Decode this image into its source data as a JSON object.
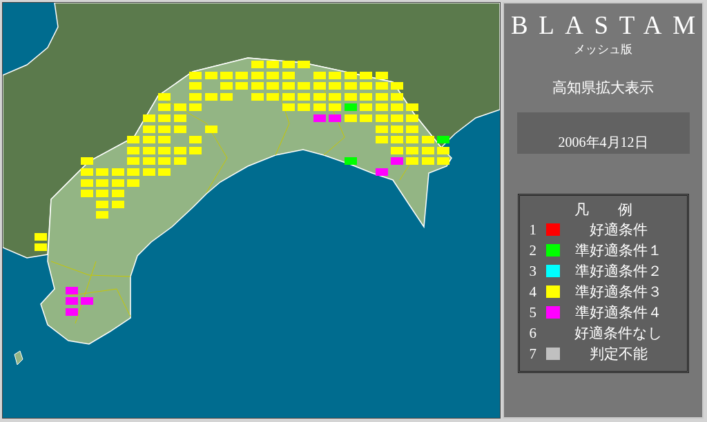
{
  "map": {
    "mesh_rows": [
      {
        "cells": [
          {
            "kind": "blank"
          },
          {
            "kind": "blank"
          },
          {
            "kind": "blank"
          },
          {
            "kind": "blank"
          },
          {
            "kind": "blank"
          },
          {
            "kind": "blank"
          },
          {
            "kind": "blank"
          },
          {
            "kind": "blank"
          },
          {
            "kind": "blank"
          },
          {
            "kind": "blank"
          },
          {
            "kind": "blank"
          },
          {
            "kind": "blank"
          },
          {
            "kind": "blank"
          },
          {
            "kind": "blank"
          },
          {
            "kind": "mesh",
            "color": "#ffff00"
          },
          {
            "kind": "mesh",
            "color": "#ffff00"
          },
          {
            "kind": "mesh",
            "color": "#ffff00"
          },
          {
            "kind": "mesh",
            "color": "#ffff00"
          }
        ]
      },
      {
        "cells": [
          {
            "kind": "blank"
          },
          {
            "kind": "blank"
          },
          {
            "kind": "blank"
          },
          {
            "kind": "blank"
          },
          {
            "kind": "blank"
          },
          {
            "kind": "blank"
          },
          {
            "kind": "blank"
          },
          {
            "kind": "blank"
          },
          {
            "kind": "blank"
          },
          {
            "kind": "blank"
          },
          {
            "kind": "mesh",
            "color": "#ffff00"
          },
          {
            "kind": "mesh",
            "color": "#ffff00"
          },
          {
            "kind": "mesh",
            "color": "#ffff00"
          },
          {
            "kind": "mesh",
            "color": "#ffff00"
          },
          {
            "kind": "mesh",
            "color": "#ffff00"
          },
          {
            "kind": "mesh",
            "color": "#ffff00"
          },
          {
            "kind": "mesh",
            "color": "#ffff00"
          },
          {
            "kind": "blank"
          },
          {
            "kind": "mesh",
            "color": "#ffff00"
          },
          {
            "kind": "mesh",
            "color": "#ffff00"
          },
          {
            "kind": "mesh",
            "color": "#ffff00"
          },
          {
            "kind": "mesh",
            "color": "#ffff00"
          },
          {
            "kind": "mesh",
            "color": "#ffff00"
          }
        ]
      },
      {
        "cells": [
          {
            "kind": "blank"
          },
          {
            "kind": "blank"
          },
          {
            "kind": "blank"
          },
          {
            "kind": "blank"
          },
          {
            "kind": "blank"
          },
          {
            "kind": "blank"
          },
          {
            "kind": "blank"
          },
          {
            "kind": "blank"
          },
          {
            "kind": "blank"
          },
          {
            "kind": "blank"
          },
          {
            "kind": "mesh",
            "color": "#ffff00"
          },
          {
            "kind": "blank"
          },
          {
            "kind": "mesh",
            "color": "#ffff00"
          },
          {
            "kind": "mesh",
            "color": "#ffff00"
          },
          {
            "kind": "mesh",
            "color": "#ffff00"
          },
          {
            "kind": "mesh",
            "color": "#ffff00"
          },
          {
            "kind": "mesh",
            "color": "#ffff00"
          },
          {
            "kind": "mesh",
            "color": "#ffff00"
          },
          {
            "kind": "mesh",
            "color": "#ffff00"
          },
          {
            "kind": "mesh",
            "color": "#ffff00"
          },
          {
            "kind": "mesh",
            "color": "#ffff00"
          },
          {
            "kind": "mesh",
            "color": "#ffff00"
          },
          {
            "kind": "mesh",
            "color": "#ffff00"
          },
          {
            "kind": "mesh",
            "color": "#ffff00"
          }
        ]
      },
      {
        "cells": [
          {
            "kind": "blank"
          },
          {
            "kind": "blank"
          },
          {
            "kind": "blank"
          },
          {
            "kind": "blank"
          },
          {
            "kind": "blank"
          },
          {
            "kind": "blank"
          },
          {
            "kind": "blank"
          },
          {
            "kind": "blank"
          },
          {
            "kind": "mesh",
            "color": "#ffff00"
          },
          {
            "kind": "blank"
          },
          {
            "kind": "mesh",
            "color": "#ffff00"
          },
          {
            "kind": "mesh",
            "color": "#ffff00"
          },
          {
            "kind": "mesh",
            "color": "#ffff00"
          },
          {
            "kind": "blank"
          },
          {
            "kind": "mesh",
            "color": "#ffff00"
          },
          {
            "kind": "mesh",
            "color": "#ffff00"
          },
          {
            "kind": "mesh",
            "color": "#ffff00"
          },
          {
            "kind": "mesh",
            "color": "#ffff00"
          },
          {
            "kind": "mesh",
            "color": "#ffff00"
          },
          {
            "kind": "mesh",
            "color": "#ffff00"
          },
          {
            "kind": "mesh",
            "color": "#ffff00"
          },
          {
            "kind": "mesh",
            "color": "#ffff00"
          },
          {
            "kind": "mesh",
            "color": "#ffff00"
          },
          {
            "kind": "mesh",
            "color": "#ffff00"
          }
        ]
      },
      {
        "cells": [
          {
            "kind": "blank"
          },
          {
            "kind": "blank"
          },
          {
            "kind": "blank"
          },
          {
            "kind": "blank"
          },
          {
            "kind": "blank"
          },
          {
            "kind": "blank"
          },
          {
            "kind": "blank"
          },
          {
            "kind": "blank"
          },
          {
            "kind": "mesh",
            "color": "#ffff00"
          },
          {
            "kind": "mesh",
            "color": "#ffff00"
          },
          {
            "kind": "mesh",
            "color": "#ffff00"
          },
          {
            "kind": "blank"
          },
          {
            "kind": "blank"
          },
          {
            "kind": "blank"
          },
          {
            "kind": "blank"
          },
          {
            "kind": "blank"
          },
          {
            "kind": "mesh",
            "color": "#ffff00"
          },
          {
            "kind": "mesh",
            "color": "#ffff00"
          },
          {
            "kind": "mesh",
            "color": "#ffff00"
          },
          {
            "kind": "mesh",
            "color": "#ffff00"
          },
          {
            "kind": "mesh",
            "color": "#00ff00"
          },
          {
            "kind": "mesh",
            "color": "#ffff00"
          },
          {
            "kind": "mesh",
            "color": "#ffff00"
          },
          {
            "kind": "mesh",
            "color": "#ffff00"
          },
          {
            "kind": "mesh",
            "color": "#ffff00"
          }
        ]
      },
      {
        "cells": [
          {
            "kind": "blank"
          },
          {
            "kind": "blank"
          },
          {
            "kind": "blank"
          },
          {
            "kind": "blank"
          },
          {
            "kind": "blank"
          },
          {
            "kind": "blank"
          },
          {
            "kind": "blank"
          },
          {
            "kind": "mesh",
            "color": "#ffff00"
          },
          {
            "kind": "mesh",
            "color": "#ffff00"
          },
          {
            "kind": "mesh",
            "color": "#ffff00"
          },
          {
            "kind": "blank"
          },
          {
            "kind": "blank"
          },
          {
            "kind": "blank"
          },
          {
            "kind": "blank"
          },
          {
            "kind": "blank"
          },
          {
            "kind": "blank"
          },
          {
            "kind": "blank"
          },
          {
            "kind": "blank"
          },
          {
            "kind": "mesh",
            "color": "#ff00ff"
          },
          {
            "kind": "mesh",
            "color": "#ff00ff"
          },
          {
            "kind": "mesh",
            "color": "#ffff00"
          },
          {
            "kind": "mesh",
            "color": "#ffff00"
          },
          {
            "kind": "mesh",
            "color": "#ffff00"
          },
          {
            "kind": "mesh",
            "color": "#ffff00"
          },
          {
            "kind": "mesh",
            "color": "#ffff00"
          }
        ]
      },
      {
        "cells": [
          {
            "kind": "blank"
          },
          {
            "kind": "blank"
          },
          {
            "kind": "blank"
          },
          {
            "kind": "blank"
          },
          {
            "kind": "blank"
          },
          {
            "kind": "blank"
          },
          {
            "kind": "blank"
          },
          {
            "kind": "mesh",
            "color": "#ffff00"
          },
          {
            "kind": "mesh",
            "color": "#ffff00"
          },
          {
            "kind": "mesh",
            "color": "#ffff00"
          },
          {
            "kind": "blank"
          },
          {
            "kind": "mesh",
            "color": "#ffff00"
          },
          {
            "kind": "blank"
          },
          {
            "kind": "blank"
          },
          {
            "kind": "blank"
          },
          {
            "kind": "blank"
          },
          {
            "kind": "blank"
          },
          {
            "kind": "blank"
          },
          {
            "kind": "blank"
          },
          {
            "kind": "blank"
          },
          {
            "kind": "blank"
          },
          {
            "kind": "blank"
          },
          {
            "kind": "mesh",
            "color": "#ffff00"
          },
          {
            "kind": "mesh",
            "color": "#ffff00"
          },
          {
            "kind": "mesh",
            "color": "#ffff00"
          }
        ]
      },
      {
        "cells": [
          {
            "kind": "blank"
          },
          {
            "kind": "blank"
          },
          {
            "kind": "blank"
          },
          {
            "kind": "blank"
          },
          {
            "kind": "blank"
          },
          {
            "kind": "blank"
          },
          {
            "kind": "mesh",
            "color": "#ffff00"
          },
          {
            "kind": "mesh",
            "color": "#ffff00"
          },
          {
            "kind": "mesh",
            "color": "#ffff00"
          },
          {
            "kind": "blank"
          },
          {
            "kind": "mesh",
            "color": "#ffff00"
          },
          {
            "kind": "blank"
          },
          {
            "kind": "blank"
          },
          {
            "kind": "blank"
          },
          {
            "kind": "blank"
          },
          {
            "kind": "blank"
          },
          {
            "kind": "blank"
          },
          {
            "kind": "blank"
          },
          {
            "kind": "blank"
          },
          {
            "kind": "blank"
          },
          {
            "kind": "blank"
          },
          {
            "kind": "blank"
          },
          {
            "kind": "mesh",
            "color": "#ffff00"
          },
          {
            "kind": "mesh",
            "color": "#ffff00"
          },
          {
            "kind": "mesh",
            "color": "#ffff00"
          },
          {
            "kind": "mesh",
            "color": "#ffff00"
          },
          {
            "kind": "mesh",
            "color": "#00ff00"
          }
        ]
      },
      {
        "cells": [
          {
            "kind": "blank"
          },
          {
            "kind": "blank"
          },
          {
            "kind": "blank"
          },
          {
            "kind": "blank"
          },
          {
            "kind": "blank"
          },
          {
            "kind": "blank"
          },
          {
            "kind": "mesh",
            "color": "#ffff00"
          },
          {
            "kind": "mesh",
            "color": "#ffff00"
          },
          {
            "kind": "mesh",
            "color": "#ffff00"
          },
          {
            "kind": "mesh",
            "color": "#ffff00"
          },
          {
            "kind": "mesh",
            "color": "#ffff00"
          },
          {
            "kind": "blank"
          },
          {
            "kind": "blank"
          },
          {
            "kind": "blank"
          },
          {
            "kind": "blank"
          },
          {
            "kind": "blank"
          },
          {
            "kind": "blank"
          },
          {
            "kind": "blank"
          },
          {
            "kind": "blank"
          },
          {
            "kind": "blank"
          },
          {
            "kind": "blank"
          },
          {
            "kind": "blank"
          },
          {
            "kind": "blank"
          },
          {
            "kind": "mesh",
            "color": "#ffff00"
          },
          {
            "kind": "mesh",
            "color": "#ffff00"
          },
          {
            "kind": "mesh",
            "color": "#ffff00"
          },
          {
            "kind": "mesh",
            "color": "#ffff00"
          }
        ]
      },
      {
        "cells": [
          {
            "kind": "blank"
          },
          {
            "kind": "blank"
          },
          {
            "kind": "blank"
          },
          {
            "kind": "mesh",
            "color": "#ffff00"
          },
          {
            "kind": "blank"
          },
          {
            "kind": "blank"
          },
          {
            "kind": "mesh",
            "color": "#ffff00"
          },
          {
            "kind": "mesh",
            "color": "#ffff00"
          },
          {
            "kind": "mesh",
            "color": "#ffff00"
          },
          {
            "kind": "mesh",
            "color": "#ffff00"
          },
          {
            "kind": "blank"
          },
          {
            "kind": "blank"
          },
          {
            "kind": "blank"
          },
          {
            "kind": "blank"
          },
          {
            "kind": "blank"
          },
          {
            "kind": "blank"
          },
          {
            "kind": "blank"
          },
          {
            "kind": "blank"
          },
          {
            "kind": "blank"
          },
          {
            "kind": "blank"
          },
          {
            "kind": "mesh",
            "color": "#00ff00"
          },
          {
            "kind": "blank"
          },
          {
            "kind": "blank"
          },
          {
            "kind": "mesh",
            "color": "#ff00ff"
          },
          {
            "kind": "mesh",
            "color": "#ffff00"
          },
          {
            "kind": "mesh",
            "color": "#ffff00"
          },
          {
            "kind": "mesh",
            "color": "#ffff00"
          }
        ]
      },
      {
        "cells": [
          {
            "kind": "blank"
          },
          {
            "kind": "blank"
          },
          {
            "kind": "blank"
          },
          {
            "kind": "mesh",
            "color": "#ffff00"
          },
          {
            "kind": "mesh",
            "color": "#ffff00"
          },
          {
            "kind": "mesh",
            "color": "#ffff00"
          },
          {
            "kind": "mesh",
            "color": "#ffff00"
          },
          {
            "kind": "mesh",
            "color": "#ffff00"
          },
          {
            "kind": "mesh",
            "color": "#ffff00"
          },
          {
            "kind": "blank"
          },
          {
            "kind": "blank"
          },
          {
            "kind": "blank"
          },
          {
            "kind": "blank"
          },
          {
            "kind": "blank"
          },
          {
            "kind": "blank"
          },
          {
            "kind": "blank"
          },
          {
            "kind": "blank"
          },
          {
            "kind": "blank"
          },
          {
            "kind": "blank"
          },
          {
            "kind": "blank"
          },
          {
            "kind": "blank"
          },
          {
            "kind": "blank"
          },
          {
            "kind": "mesh",
            "color": "#ff00ff"
          }
        ]
      },
      {
        "cells": [
          {
            "kind": "blank"
          },
          {
            "kind": "blank"
          },
          {
            "kind": "blank"
          },
          {
            "kind": "mesh",
            "color": "#ffff00"
          },
          {
            "kind": "mesh",
            "color": "#ffff00"
          },
          {
            "kind": "mesh",
            "color": "#ffff00"
          },
          {
            "kind": "mesh",
            "color": "#ffff00"
          }
        ]
      },
      {
        "cells": [
          {
            "kind": "blank"
          },
          {
            "kind": "blank"
          },
          {
            "kind": "blank"
          },
          {
            "kind": "mesh",
            "color": "#ffff00"
          },
          {
            "kind": "mesh",
            "color": "#ffff00"
          },
          {
            "kind": "mesh",
            "color": "#ffff00"
          }
        ]
      },
      {
        "cells": [
          {
            "kind": "blank"
          },
          {
            "kind": "blank"
          },
          {
            "kind": "blank"
          },
          {
            "kind": "blank"
          },
          {
            "kind": "mesh",
            "color": "#ffff00"
          },
          {
            "kind": "mesh",
            "color": "#ffff00"
          }
        ]
      },
      {
        "cells": [
          {
            "kind": "blank"
          },
          {
            "kind": "blank"
          },
          {
            "kind": "blank"
          },
          {
            "kind": "blank"
          },
          {
            "kind": "mesh",
            "color": "#ffff00"
          }
        ]
      },
      {
        "cells": [
          {
            "kind": "blank"
          }
        ]
      },
      {
        "cells": [
          {
            "kind": "mesh",
            "color": "#ffff00"
          }
        ]
      },
      {
        "cells": [
          {
            "kind": "mesh",
            "color": "#ffff00"
          }
        ]
      },
      {
        "cells": [
          {
            "kind": "blank"
          }
        ]
      },
      {
        "cells": [
          {
            "kind": "blank"
          }
        ]
      },
      {
        "cells": [
          {
            "kind": "blank"
          }
        ]
      },
      {
        "cells": [
          {
            "kind": "blank"
          },
          {
            "kind": "blank"
          },
          {
            "kind": "mesh",
            "color": "#ff00ff"
          }
        ]
      },
      {
        "cells": [
          {
            "kind": "blank"
          },
          {
            "kind": "blank"
          },
          {
            "kind": "mesh",
            "color": "#ff00ff"
          },
          {
            "kind": "mesh",
            "color": "#ff00ff"
          }
        ]
      },
      {
        "cells": [
          {
            "kind": "blank"
          },
          {
            "kind": "blank"
          },
          {
            "kind": "mesh",
            "color": "#ff00ff"
          }
        ]
      }
    ]
  },
  "panel": {
    "title": "BLASTAM",
    "subtitle": "メッシュ版",
    "view": "高知県拡大表示",
    "date": "2006年4月12日",
    "legend": {
      "title": "凡　　例",
      "items": [
        {
          "number": "1",
          "color": "#ff0000",
          "label": "好適条件"
        },
        {
          "number": "2",
          "color": "#00ff00",
          "label": "準好適条件１"
        },
        {
          "number": "3",
          "color": "#00ffff",
          "label": "準好適条件２"
        },
        {
          "number": "4",
          "color": "#ffff00",
          "label": "準好適条件３"
        },
        {
          "number": "5",
          "color": "#ff00ff",
          "label": "準好適条件４"
        },
        {
          "number": "6",
          "label": "好適条件なし"
        },
        {
          "number": "7",
          "color": "#c0c0c0",
          "label": "判定不能"
        }
      ]
    }
  }
}
